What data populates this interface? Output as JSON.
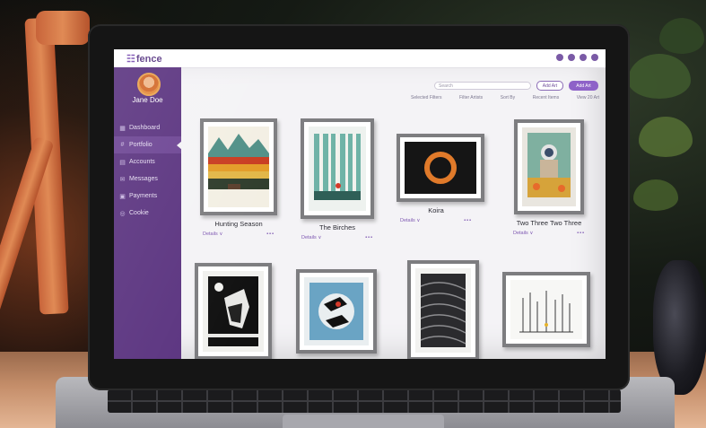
{
  "app": {
    "logo": "fence",
    "logo_mark": "☷"
  },
  "user": {
    "name": "Jane Doe"
  },
  "sidebar": {
    "items": [
      {
        "label": "Dashboard",
        "icon": "grid-icon",
        "glyph": "▦",
        "active": false
      },
      {
        "label": "Portfolio",
        "icon": "portfolio-icon",
        "glyph": "#",
        "active": true
      },
      {
        "label": "Accounts",
        "icon": "accounts-icon",
        "glyph": "▤",
        "active": false
      },
      {
        "label": "Messages",
        "icon": "messages-icon",
        "glyph": "✉",
        "active": false
      },
      {
        "label": "Payments",
        "icon": "payments-icon",
        "glyph": "▣",
        "active": false
      },
      {
        "label": "Cookie",
        "icon": "cookie-icon",
        "glyph": "◎",
        "active": false
      }
    ]
  },
  "toolbar": {
    "search_placeholder": "Search",
    "outline_button": "Add Art",
    "fill_button": "Add Art"
  },
  "filters": [
    "Selected Filters",
    "Filter Artists",
    "Sort By",
    "Recent Items",
    "View 20 Art"
  ],
  "artworks": [
    {
      "title": "Hunting Season",
      "details": "Details ∨",
      "more": "•••"
    },
    {
      "title": "The Birches",
      "details": "Details ∨",
      "more": "•••"
    },
    {
      "title": "Koira",
      "details": "Details ∨",
      "more": "•••"
    },
    {
      "title": "Two Three Two Three",
      "details": "Details ∨",
      "more": "•••"
    },
    {
      "title": "",
      "details": "",
      "more": ""
    },
    {
      "title": "",
      "details": "",
      "more": ""
    },
    {
      "title": "",
      "details": "",
      "more": ""
    },
    {
      "title": "",
      "details": "",
      "more": ""
    }
  ],
  "colors": {
    "sidebar": "#5b3480",
    "accent": "#8e62c8",
    "screen_bg": "#f4f3f6"
  }
}
